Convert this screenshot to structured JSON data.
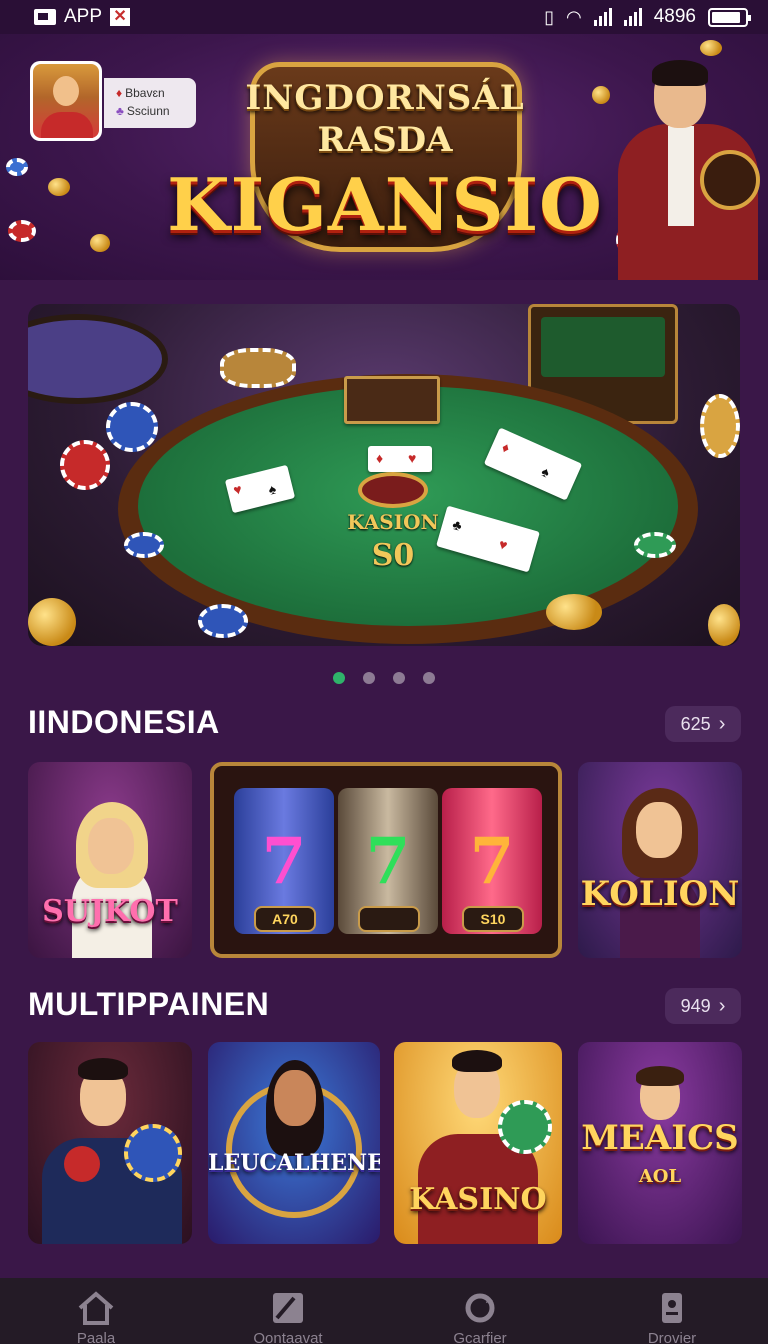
{
  "status_bar": {
    "app_label": "APP",
    "battery_text": "4896"
  },
  "hero": {
    "title_line1": "INGDORNSÁL",
    "title_line2": "RASDA",
    "title_main": "KIGANSIO",
    "profile": {
      "line1": "Bbavɛn",
      "line2": "Ssciunn"
    }
  },
  "banner": {
    "table_label": "KASION",
    "table_value": "S0",
    "carousel_count": 4,
    "active_index": 0
  },
  "sections": [
    {
      "title": "IINDONESIA",
      "count": "625",
      "tiles": [
        {
          "label": "SUJKOT"
        },
        {
          "label": "",
          "reels": [
            "7",
            "7",
            "7"
          ],
          "plates": [
            "A70",
            "",
            "S10"
          ]
        },
        {
          "label": "KOLION"
        }
      ]
    },
    {
      "title": "MULTIPPAINEN",
      "count": "949",
      "tiles": [
        {
          "label": ""
        },
        {
          "label": "LEUCALHENE"
        },
        {
          "label": "KASINO"
        },
        {
          "label": "MEAICS",
          "sublabel": "AOL"
        }
      ]
    }
  ],
  "bottom_nav": [
    {
      "label": "Paala",
      "icon": "home-icon"
    },
    {
      "label": "Oontaavat",
      "icon": "image-icon"
    },
    {
      "label": "Gcarfier",
      "icon": "refresh-icon"
    },
    {
      "label": "Drovier",
      "icon": "profile-card-icon"
    }
  ],
  "colors": {
    "background": "#3a1748",
    "accent_active_dot": "#2fb36a",
    "gold": "#ffd55e",
    "nav_bg": "#241b26"
  }
}
